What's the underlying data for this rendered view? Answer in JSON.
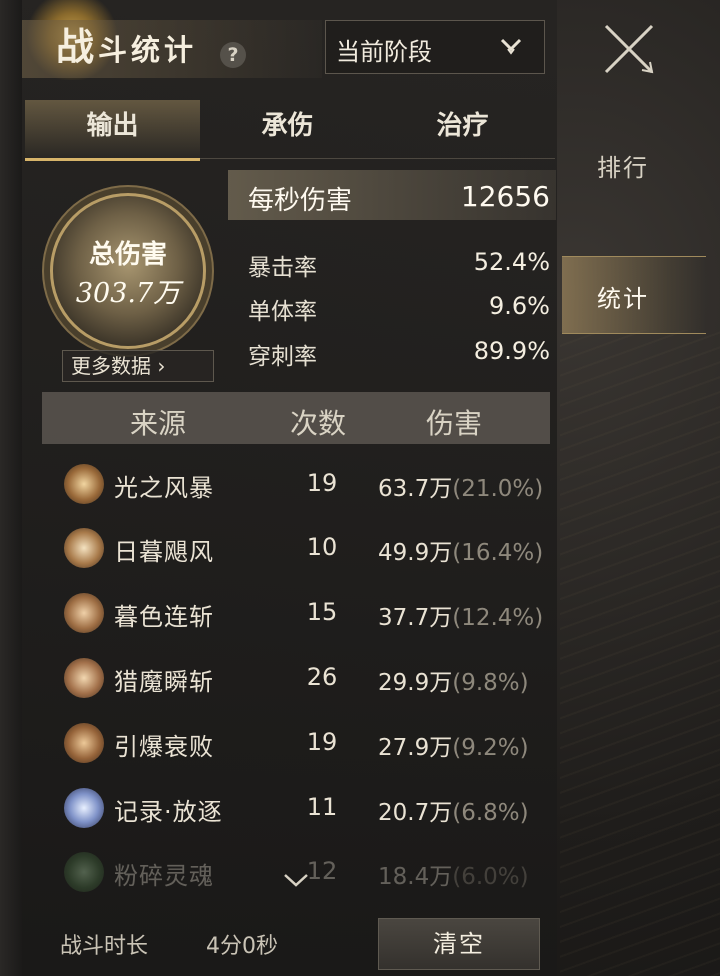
{
  "header": {
    "title_big": "战",
    "title_rest": "斗统计",
    "help_icon": "question-icon",
    "phase_label": "当前阶段"
  },
  "sidebar": {
    "rank_label": "排行",
    "stats_label": "统计",
    "close_icon": "close-x-icon"
  },
  "tabs": [
    {
      "label": "输出",
      "active": true
    },
    {
      "label": "承伤",
      "active": false
    },
    {
      "label": "治疗",
      "active": false
    }
  ],
  "summary": {
    "total_label": "总伤害",
    "total_value": "303.7万",
    "more_label": "更多数据",
    "dps_label": "每秒伤害",
    "dps_value": "12656",
    "stats": [
      {
        "label": "暴击率",
        "value": "52.4%"
      },
      {
        "label": "单体率",
        "value": "9.6%"
      },
      {
        "label": "穿刺率",
        "value": "89.9%"
      }
    ]
  },
  "table": {
    "headers": [
      "来源",
      "次数",
      "伤害"
    ],
    "rows": [
      {
        "name": "光之风暴",
        "count": "19",
        "damage": "63.7万",
        "pct": "(21.0%)",
        "icon": "light-storm-icon"
      },
      {
        "name": "日暮飓风",
        "count": "10",
        "damage": "49.9万",
        "pct": "(16.4%)",
        "icon": "dusk-hurricane-icon"
      },
      {
        "name": "暮色连斩",
        "count": "15",
        "damage": "37.7万",
        "pct": "(12.4%)",
        "icon": "twilight-slash-icon"
      },
      {
        "name": "猎魔瞬斩",
        "count": "26",
        "damage": "29.9万",
        "pct": "(9.8%)",
        "icon": "demon-hunt-slash-icon"
      },
      {
        "name": "引爆衰败",
        "count": "19",
        "damage": "27.9万",
        "pct": "(9.2%)",
        "icon": "detonate-decay-icon"
      },
      {
        "name": "记录·放逐",
        "count": "11",
        "damage": "20.7万",
        "pct": "(6.8%)",
        "icon": "record-exile-icon"
      },
      {
        "name": "粉碎灵魂",
        "count": "12",
        "damage": "18.4万",
        "pct": "(6.0%)",
        "icon": "shatter-soul-icon"
      }
    ]
  },
  "footer": {
    "duration_label": "战斗时长",
    "duration_value": "4分0秒",
    "clear_label": "清空"
  },
  "colors": {
    "accent": "#d7b46a",
    "panel": "#262422",
    "text": "#e9e3d6",
    "muted": "#8e887c"
  }
}
